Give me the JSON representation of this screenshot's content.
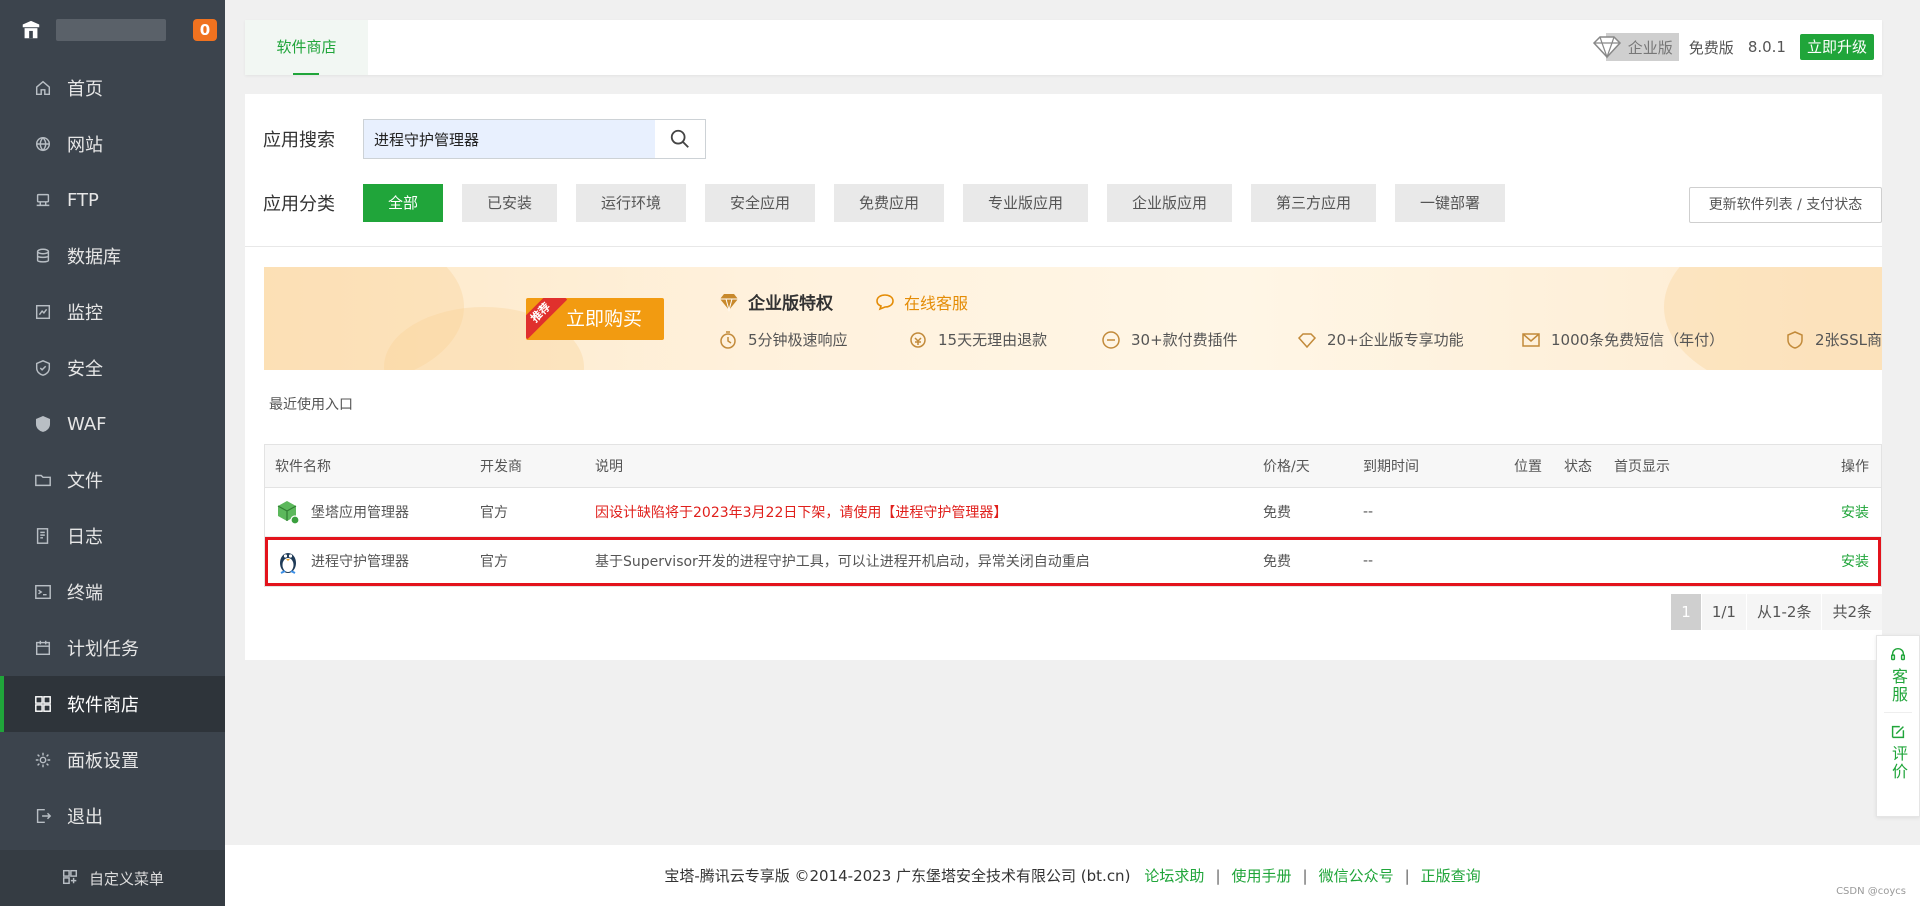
{
  "sidebar": {
    "server_ip": "",
    "badge": "0",
    "items": [
      {
        "label": "首页",
        "icon": "home-icon"
      },
      {
        "label": "网站",
        "icon": "globe-icon"
      },
      {
        "label": "FTP",
        "icon": "ftp-icon"
      },
      {
        "label": "数据库",
        "icon": "database-icon"
      },
      {
        "label": "监控",
        "icon": "monitor-icon"
      },
      {
        "label": "安全",
        "icon": "shield-check-icon"
      },
      {
        "label": "WAF",
        "icon": "waf-shield-icon"
      },
      {
        "label": "文件",
        "icon": "folder-icon"
      },
      {
        "label": "日志",
        "icon": "log-icon"
      },
      {
        "label": "终端",
        "icon": "terminal-icon"
      },
      {
        "label": "计划任务",
        "icon": "calendar-icon"
      },
      {
        "label": "软件商店",
        "icon": "app-grid-icon",
        "active": true
      },
      {
        "label": "面板设置",
        "icon": "gear-icon"
      },
      {
        "label": "退出",
        "icon": "logout-icon"
      }
    ],
    "custom_menu": "自定义菜单"
  },
  "topbar": {
    "tab": "软件商店",
    "enterprise": "企业版",
    "free": "免费版",
    "version": "8.0.1",
    "upgrade": "立即升级"
  },
  "search": {
    "label": "应用搜索",
    "value": "进程守护管理器"
  },
  "category": {
    "label": "应用分类",
    "items": [
      "全部",
      "已安装",
      "运行环境",
      "安全应用",
      "免费应用",
      "专业版应用",
      "企业版应用",
      "第三方应用",
      "一键部署"
    ],
    "update_button": "更新软件列表 / 支付状态"
  },
  "banner": {
    "ribbon": "推荐",
    "buy": "立即购买",
    "title": "企业版特权",
    "service": "在线客服",
    "features": [
      "5分钟极速响应",
      "15天无理由退款",
      "30+款付费插件",
      "20+企业版专享功能",
      "1000条免费短信（年付）",
      "2张SSL商..."
    ]
  },
  "recent_label": "最近使用入口",
  "table": {
    "headers": {
      "name": "软件名称",
      "dev": "开发商",
      "desc": "说明",
      "price": "价格/天",
      "expire": "到期时间",
      "pos": "位置",
      "status": "状态",
      "home": "首页显示",
      "op": "操作"
    },
    "rows": [
      {
        "name": "堡塔应用管理器",
        "dev": "官方",
        "desc": "因设计缺陷将于2023年3月22日下架，请使用【进程守护管理器】",
        "price": "免费",
        "expire": "--",
        "op": "安装"
      },
      {
        "name": "进程守护管理器",
        "dev": "官方",
        "desc": "基于Supervisor开发的进程守护工具，可以让进程开机启动，异常关闭自动重启",
        "price": "免费",
        "expire": "--",
        "op": "安装"
      }
    ]
  },
  "pager": {
    "current": "1",
    "total_pages": "1/1",
    "range": "从1-2条",
    "total": "共2条"
  },
  "footer": {
    "copyright": "宝塔-腾讯云专享版 ©2014-2023 广东堡塔安全技术有限公司 (bt.cn)",
    "links": [
      "论坛求助",
      "使用手册",
      "微信公众号",
      "正版查询"
    ],
    "watermark": "CSDN @coycs"
  },
  "floatbar": {
    "service": "客服",
    "review": "评价"
  },
  "colors": {
    "brand_green": "#20a53a",
    "sidebar_bg": "#3c444d",
    "badge_orange": "#f0721f",
    "highlight_red": "#e3131c",
    "buy_orange": "#f29b11"
  }
}
